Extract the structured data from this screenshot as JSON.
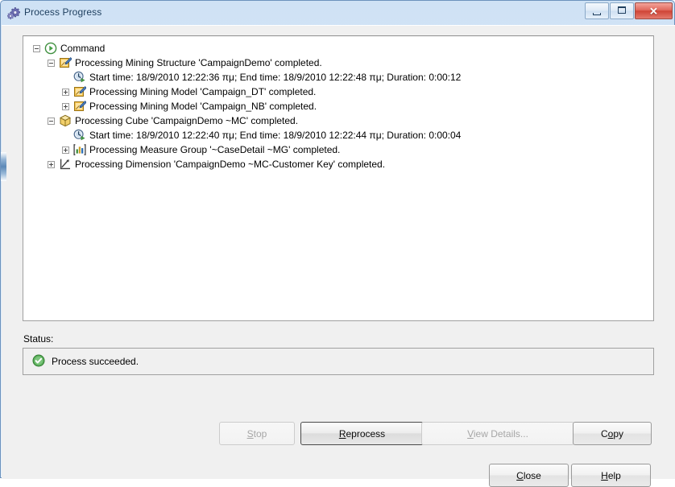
{
  "window": {
    "title": "Process Progress",
    "icon": "gears-icon",
    "buttons": {
      "minimize": "minimize-button",
      "maximize": "maximize-button",
      "close_glyph": "✕"
    }
  },
  "tree": {
    "nodes": [
      {
        "level": 0,
        "expander": "minus",
        "icon": "play-circle-icon",
        "label": "Command"
      },
      {
        "level": 1,
        "expander": "minus",
        "icon": "mining-structure-icon",
        "label": "Processing Mining Structure 'CampaignDemo' completed."
      },
      {
        "level": 2,
        "expander": "none",
        "icon": "clock-run-icon",
        "label": "Start time: 18/9/2010 12:22:36 πμ; End time: 18/9/2010 12:22:48 πμ; Duration: 0:00:12"
      },
      {
        "level": 2,
        "expander": "plus",
        "icon": "mining-model-icon",
        "label": "Processing Mining Model 'Campaign_DT' completed."
      },
      {
        "level": 2,
        "expander": "plus",
        "icon": "mining-model-icon",
        "label": "Processing Mining Model 'Campaign_NB' completed."
      },
      {
        "level": 1,
        "expander": "minus",
        "icon": "cube-icon",
        "label": "Processing Cube 'CampaignDemo ~MC' completed."
      },
      {
        "level": 2,
        "expander": "none",
        "icon": "clock-run-icon",
        "label": "Start time: 18/9/2010 12:22:40 πμ; End time: 18/9/2010 12:22:44 πμ; Duration: 0:00:04"
      },
      {
        "level": 2,
        "expander": "plus",
        "icon": "measure-group-icon",
        "label": "Processing Measure Group '~CaseDetail ~MG' completed."
      },
      {
        "level": 1,
        "expander": "plus",
        "icon": "dimension-icon",
        "label": "Processing Dimension 'CampaignDemo ~MC-Customer Key' completed."
      }
    ]
  },
  "status": {
    "label": "Status:",
    "icon": "success-check-icon",
    "text": "Process succeeded."
  },
  "buttons": {
    "stop": {
      "prefix": "",
      "accel": "S",
      "suffix": "top",
      "enabled": false
    },
    "reprocess": {
      "prefix": "",
      "accel": "R",
      "suffix": "eprocess",
      "enabled": true,
      "focused": true
    },
    "view_details": {
      "prefix": "",
      "accel": "V",
      "suffix": "iew Details...",
      "enabled": false
    },
    "copy": {
      "prefix": "C",
      "accel": "o",
      "suffix": "py",
      "enabled": true
    },
    "close": {
      "prefix": "",
      "accel": "C",
      "suffix": "lose",
      "enabled": true
    },
    "help": {
      "prefix": "",
      "accel": "H",
      "suffix": "elp",
      "enabled": true
    }
  },
  "colors": {
    "title_gradient_top": "#cfe2f5",
    "title_text": "#204060",
    "close_button": "#cf4436",
    "success_green": "#3a9b3a",
    "dialog_bg": "#f0f0f0",
    "panel_bg": "#ffffff"
  }
}
